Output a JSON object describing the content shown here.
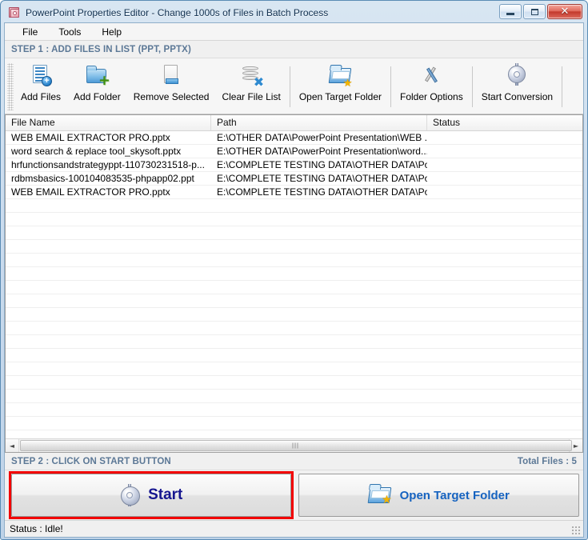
{
  "window": {
    "title": "PowerPoint Properties Editor - Change 1000s of Files in Batch Process",
    "app_icon": "powerpoint-properties-icon",
    "controls": {
      "minimize": "–",
      "maximize": "□",
      "close": "✕"
    }
  },
  "menu": {
    "items": [
      {
        "label": "File"
      },
      {
        "label": "Tools"
      },
      {
        "label": "Help"
      }
    ]
  },
  "step1": {
    "title": "STEP 1 : ADD FILES IN LIST (PPT, PPTX)"
  },
  "toolbar": {
    "buttons": [
      {
        "label": "Add Files",
        "icon": "add-files-icon"
      },
      {
        "label": "Add Folder",
        "icon": "add-folder-icon"
      },
      {
        "label": "Remove Selected",
        "icon": "remove-selected-icon"
      },
      {
        "label": "Clear File List",
        "icon": "clear-file-list-icon"
      },
      {
        "label": "Open Target Folder",
        "icon": "open-target-folder-icon"
      },
      {
        "label": "Folder Options",
        "icon": "folder-options-icon"
      },
      {
        "label": "Start Conversion",
        "icon": "start-conversion-icon"
      }
    ]
  },
  "file_list": {
    "columns": [
      "File Name",
      "Path",
      "Status"
    ],
    "rows": [
      {
        "file_name": "WEB EMAIL EXTRACTOR PRO.pptx",
        "path": "E:\\OTHER DATA\\PowerPoint Presentation\\WEB ...",
        "status": ""
      },
      {
        "file_name": "word search & replace tool_skysoft.pptx",
        "path": "E:\\OTHER DATA\\PowerPoint Presentation\\word...",
        "status": ""
      },
      {
        "file_name": "hrfunctionsandstrategyppt-110730231518-p...",
        "path": "E:\\COMPLETE TESTING DATA\\OTHER DATA\\Po...",
        "status": ""
      },
      {
        "file_name": "rdbmsbasics-100104083535-phpapp02.ppt",
        "path": "E:\\COMPLETE TESTING DATA\\OTHER DATA\\Po...",
        "status": ""
      },
      {
        "file_name": "WEB EMAIL EXTRACTOR PRO.pptx",
        "path": "E:\\COMPLETE TESTING DATA\\OTHER DATA\\Po...",
        "status": ""
      }
    ]
  },
  "scrollbar": {
    "left_arrow": "◄",
    "right_arrow": "►"
  },
  "step2": {
    "title": "STEP 2 : CLICK ON START BUTTON",
    "total_files": "Total Files : 5"
  },
  "actions": {
    "start": {
      "label": "Start",
      "icon": "gear-icon",
      "highlight_color": "#f20000"
    },
    "open_target_folder": {
      "label": "Open Target Folder",
      "icon": "open-folder-icon"
    }
  },
  "statusbar": {
    "text": "Status  :  Idle!"
  },
  "colors": {
    "step_text": "#5c7896",
    "start_text": "#15158f",
    "open_target_text": "#1663c0",
    "highlight_border": "#f20000",
    "title_text": "#103050"
  }
}
